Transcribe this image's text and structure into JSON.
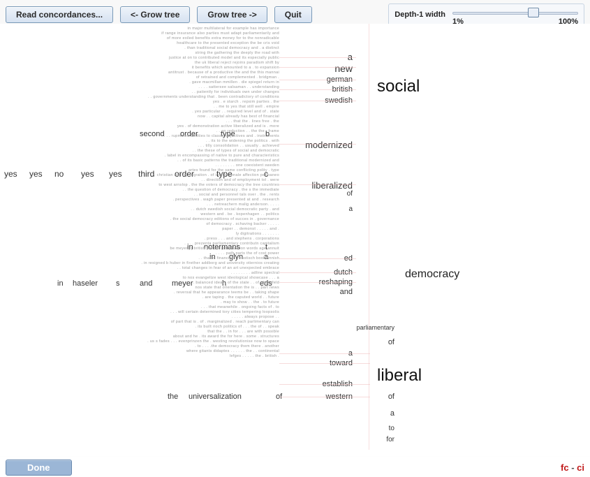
{
  "toolbar": {
    "read": "Read concordances...",
    "grow_left": "<- Grow tree",
    "grow_right": "Grow tree ->",
    "quit": "Quit"
  },
  "slider": {
    "label": "Depth-1 width",
    "min": "1%",
    "max": "100%"
  },
  "bottom": {
    "done": "Done",
    "fc": "fc",
    "dash": " - ",
    "ci": "ci"
  },
  "salient": {
    "social": "social",
    "liberal": "liberal",
    "democracy": "democracy",
    "new": "new",
    "german": "german",
    "british": "british",
    "swedish": "swedish",
    "a1": "a",
    "modernized": "modernized",
    "liberalized": "liberalized",
    "of1": "of",
    "a2": "a",
    "ed": "ed",
    "dutch": "dutch",
    "reshaping": "reshaping",
    "and": "and",
    "parliamentary": "parliamentary",
    "of2": "of",
    "a3": "a",
    "toward": "toward",
    "establish": "establish",
    "western": "western",
    "of3": "of",
    "a4": "a",
    "to": "to",
    "for": "for"
  },
  "midrow1": {
    "second": "second",
    "order1": "order",
    "type1": "type",
    "b": "b"
  },
  "midrow2": {
    "yes1": "yes",
    "yes2": "yes",
    "no": "no",
    "yes3": "yes",
    "yes4": "yes",
    "third": "third",
    "order2": "order",
    "type2": "type",
    "c": "c"
  },
  "midrow3": {
    "in1": "in",
    "notermans": "notermans",
    "t": "t"
  },
  "midrow4": {
    "in2": "in",
    "glyn": "glyn",
    "a": "a"
  },
  "midrow5": {
    "in": "in",
    "haseler": "haseler",
    "s": "s",
    "and": "and",
    "meyer": "meyer",
    "h": "h",
    "eds": "eds"
  },
  "midrow6": {
    "the": "the",
    "universalization": "universalization",
    "of": "of"
  }
}
